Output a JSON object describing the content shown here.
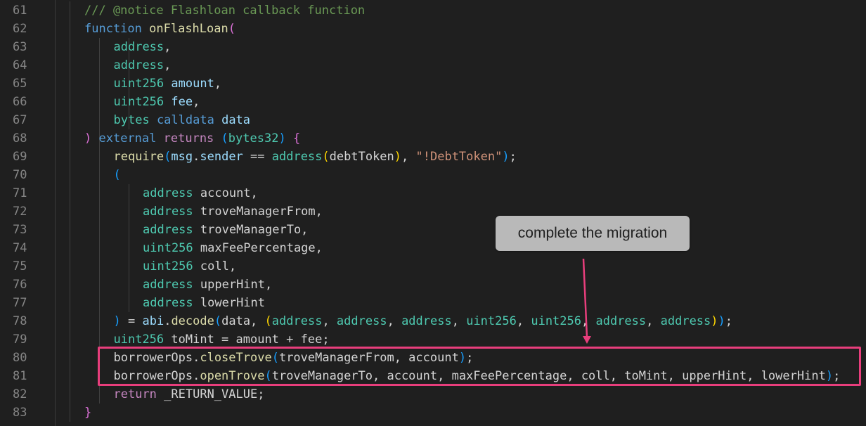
{
  "callout": {
    "text": "complete the migration"
  },
  "colors": {
    "highlight": "#e83e7c",
    "callout_bg": "#b9b9b9",
    "editor_bg": "#1f1f1f"
  },
  "lines": [
    {
      "n": "61",
      "indent": 0,
      "tokens": [
        [
          "/// @notice Flashloan callback function",
          "comment"
        ]
      ]
    },
    {
      "n": "62",
      "indent": 0,
      "tokens": [
        [
          "function",
          "keyword"
        ],
        [
          " ",
          "plain"
        ],
        [
          "onFlashLoan",
          "func"
        ],
        [
          "(",
          "p1"
        ]
      ]
    },
    {
      "n": "63",
      "indent": 1,
      "tokens": [
        [
          "address",
          "type"
        ],
        [
          ",",
          "plain"
        ]
      ]
    },
    {
      "n": "64",
      "indent": 1,
      "tokens": [
        [
          "address",
          "type"
        ],
        [
          ",",
          "plain"
        ]
      ]
    },
    {
      "n": "65",
      "indent": 1,
      "tokens": [
        [
          "uint256",
          "type"
        ],
        [
          " ",
          "plain"
        ],
        [
          "amount",
          "var"
        ],
        [
          ",",
          "plain"
        ]
      ]
    },
    {
      "n": "66",
      "indent": 1,
      "tokens": [
        [
          "uint256",
          "type"
        ],
        [
          " ",
          "plain"
        ],
        [
          "fee",
          "var"
        ],
        [
          ",",
          "plain"
        ]
      ]
    },
    {
      "n": "67",
      "indent": 1,
      "tokens": [
        [
          "bytes",
          "type"
        ],
        [
          " ",
          "plain"
        ],
        [
          "calldata",
          "keyword"
        ],
        [
          " ",
          "plain"
        ],
        [
          "data",
          "var"
        ]
      ]
    },
    {
      "n": "68",
      "indent": 0,
      "tokens": [
        [
          ")",
          "p1"
        ],
        [
          " ",
          "plain"
        ],
        [
          "external",
          "keyword"
        ],
        [
          " ",
          "plain"
        ],
        [
          "returns",
          "control"
        ],
        [
          " ",
          "plain"
        ],
        [
          "(",
          "p2"
        ],
        [
          "bytes32",
          "type"
        ],
        [
          ")",
          "p2"
        ],
        [
          " ",
          "plain"
        ],
        [
          "{",
          "p1"
        ]
      ]
    },
    {
      "n": "69",
      "indent": 1,
      "tokens": [
        [
          "require",
          "func"
        ],
        [
          "(",
          "p2"
        ],
        [
          "msg",
          "var"
        ],
        [
          ".",
          "plain"
        ],
        [
          "sender",
          "var"
        ],
        [
          " == ",
          "plain"
        ],
        [
          "address",
          "type"
        ],
        [
          "(",
          "p3"
        ],
        [
          "debtToken",
          "other"
        ],
        [
          ")",
          "p3"
        ],
        [
          ", ",
          "plain"
        ],
        [
          "\"!DebtToken\"",
          "string"
        ],
        [
          ")",
          "p2"
        ],
        [
          ";",
          "plain"
        ]
      ]
    },
    {
      "n": "70",
      "indent": 1,
      "tokens": [
        [
          "(",
          "p2"
        ]
      ]
    },
    {
      "n": "71",
      "indent": 2,
      "tokens": [
        [
          "address",
          "type"
        ],
        [
          " account,",
          "plain"
        ]
      ]
    },
    {
      "n": "72",
      "indent": 2,
      "tokens": [
        [
          "address",
          "type"
        ],
        [
          " troveManagerFrom,",
          "plain"
        ]
      ]
    },
    {
      "n": "73",
      "indent": 2,
      "tokens": [
        [
          "address",
          "type"
        ],
        [
          " troveManagerTo,",
          "plain"
        ]
      ]
    },
    {
      "n": "74",
      "indent": 2,
      "tokens": [
        [
          "uint256",
          "type"
        ],
        [
          " maxFeePercentage,",
          "plain"
        ]
      ]
    },
    {
      "n": "75",
      "indent": 2,
      "tokens": [
        [
          "uint256",
          "type"
        ],
        [
          " coll,",
          "plain"
        ]
      ]
    },
    {
      "n": "76",
      "indent": 2,
      "tokens": [
        [
          "address",
          "type"
        ],
        [
          " upperHint,",
          "plain"
        ]
      ]
    },
    {
      "n": "77",
      "indent": 2,
      "tokens": [
        [
          "address",
          "type"
        ],
        [
          " lowerHint",
          "plain"
        ]
      ]
    },
    {
      "n": "78",
      "indent": 1,
      "tokens": [
        [
          ")",
          "p2"
        ],
        [
          " = ",
          "plain"
        ],
        [
          "abi",
          "var"
        ],
        [
          ".",
          "plain"
        ],
        [
          "decode",
          "func"
        ],
        [
          "(",
          "p2"
        ],
        [
          "data, ",
          "plain"
        ],
        [
          "(",
          "p3"
        ],
        [
          "address",
          "type"
        ],
        [
          ", ",
          "plain"
        ],
        [
          "address",
          "type"
        ],
        [
          ", ",
          "plain"
        ],
        [
          "address",
          "type"
        ],
        [
          ", ",
          "plain"
        ],
        [
          "uint256",
          "type"
        ],
        [
          ", ",
          "plain"
        ],
        [
          "uint256",
          "type"
        ],
        [
          ", ",
          "plain"
        ],
        [
          "address",
          "type"
        ],
        [
          ", ",
          "plain"
        ],
        [
          "address",
          "type"
        ],
        [
          ")",
          "p3"
        ],
        [
          ")",
          "p2"
        ],
        [
          ";",
          "plain"
        ]
      ]
    },
    {
      "n": "79",
      "indent": 1,
      "tokens": [
        [
          "uint256",
          "type"
        ],
        [
          " toMint = amount + fee;",
          "plain"
        ]
      ]
    },
    {
      "n": "80",
      "indent": 1,
      "tokens": [
        [
          "borrowerOps",
          "other"
        ],
        [
          ".",
          "plain"
        ],
        [
          "closeTrove",
          "func"
        ],
        [
          "(",
          "p2"
        ],
        [
          "troveManagerFrom, account",
          "plain"
        ],
        [
          ")",
          "p2"
        ],
        [
          ";",
          "plain"
        ]
      ]
    },
    {
      "n": "81",
      "indent": 1,
      "tokens": [
        [
          "borrowerOps",
          "other"
        ],
        [
          ".",
          "plain"
        ],
        [
          "openTrove",
          "func"
        ],
        [
          "(",
          "p2"
        ],
        [
          "troveManagerTo, account, maxFeePercentage, coll, toMint, upperHint, lowerHint",
          "plain"
        ],
        [
          ")",
          "p2"
        ],
        [
          ";",
          "plain"
        ]
      ]
    },
    {
      "n": "82",
      "indent": 1,
      "tokens": [
        [
          "return",
          "control"
        ],
        [
          " _RETURN_VALUE;",
          "plain"
        ]
      ]
    },
    {
      "n": "83",
      "indent": 0,
      "tokens": [
        [
          "}",
          "p1"
        ]
      ]
    }
  ]
}
